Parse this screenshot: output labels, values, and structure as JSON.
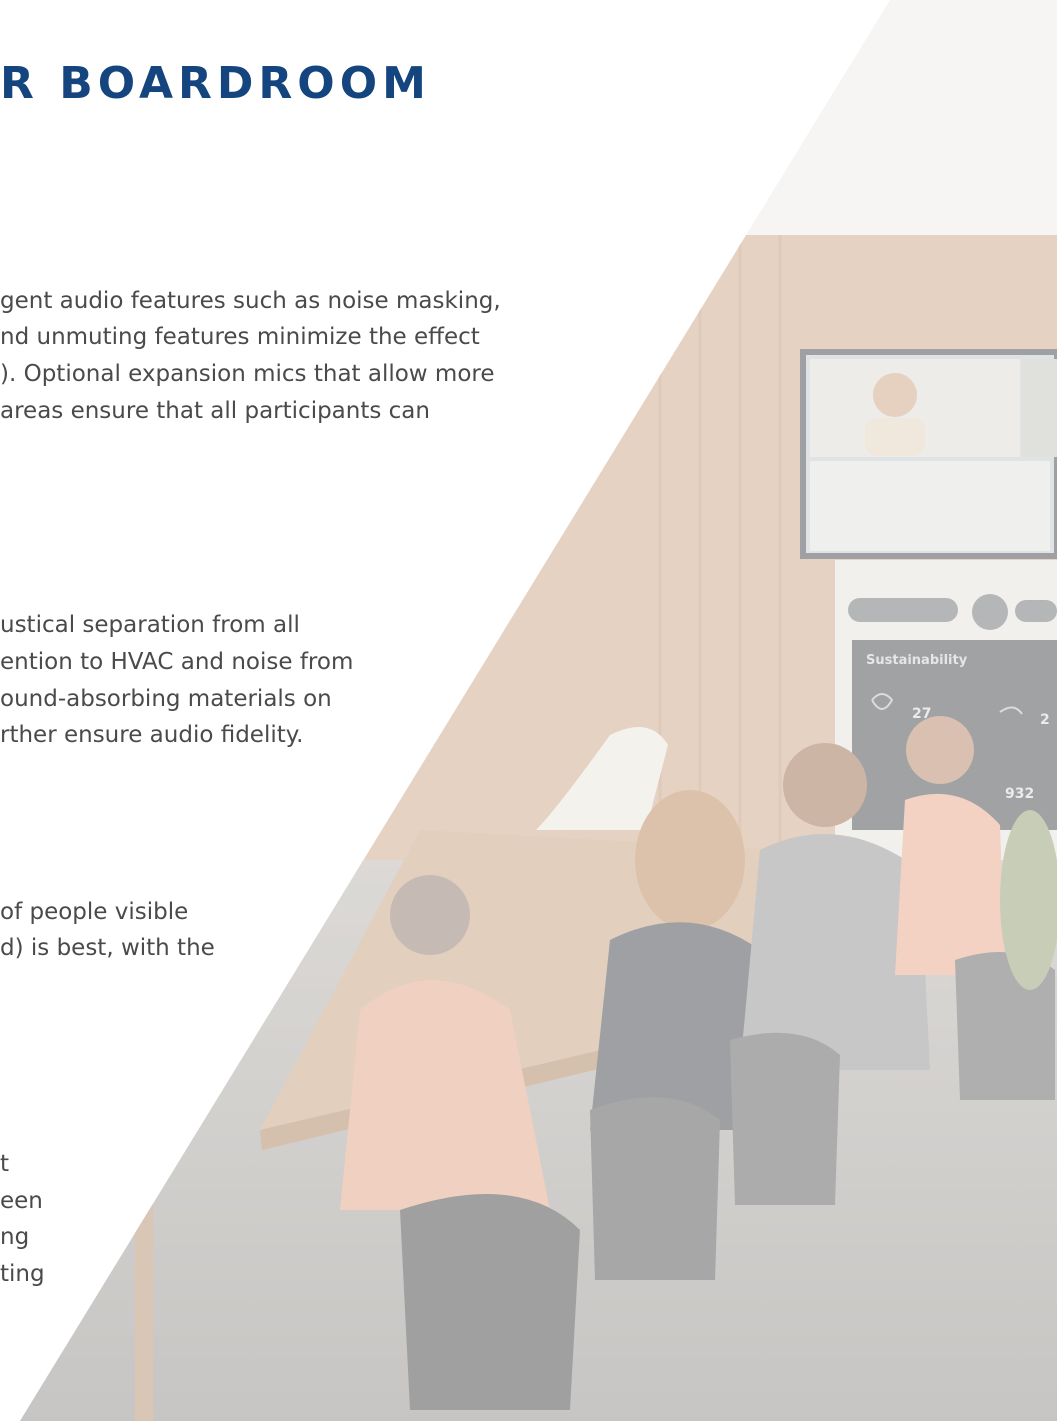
{
  "document": {
    "title": "R BOARDROOM",
    "sections": [
      {
        "lines": [
          "gent audio features such as noise masking,",
          "nd unmuting features minimize the effect",
          "). Optional expansion mics that allow more",
          " areas ensure that all participants can"
        ]
      },
      {
        "lines": [
          "ustical separation from all",
          "ention to HVAC and noise from",
          "ound-absorbing materials on",
          "rther ensure audio fidelity."
        ]
      },
      {
        "lines": [
          " of people visible",
          "d) is best, with the"
        ]
      },
      {
        "lines": [
          "t",
          "een",
          "ng",
          "ting"
        ]
      }
    ]
  },
  "photo": {
    "display_text": "Sustainability",
    "stat_values": [
      "27",
      "2",
      "932"
    ]
  },
  "colors": {
    "title": "#15457f",
    "body_text": "#4a4a4a",
    "wood_wall": "#d8bba4",
    "carpet": "#b4b2ae"
  },
  "icons": [
    "sustainability-icons"
  ]
}
